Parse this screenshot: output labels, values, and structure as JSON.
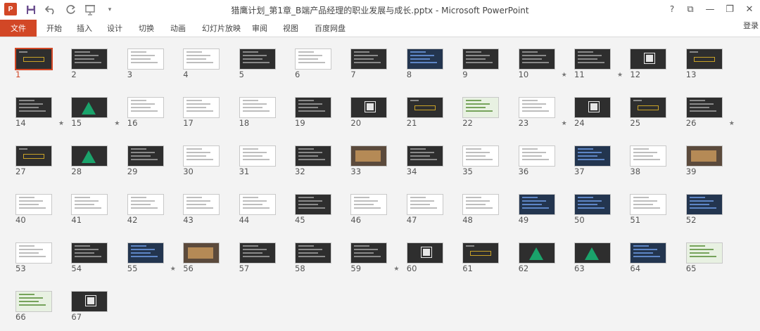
{
  "window": {
    "title": "猎鹰计划_第1章_B端产品经理的职业发展与成长.pptx - Microsoft PowerPoint",
    "app_icon": "P",
    "qat_icons": [
      "save-icon",
      "undo-icon",
      "redo-icon",
      "slideshow-icon",
      "customize-qat-icon"
    ],
    "controls": {
      "help": "?",
      "ribbon_display": "⧉",
      "minimize": "—",
      "restore": "❐",
      "close": "✕"
    }
  },
  "ribbon": {
    "file_tab": "文件",
    "tabs": [
      "开始",
      "插入",
      "设计",
      "切换",
      "动画",
      "幻灯片放映",
      "审阅",
      "视图",
      "百度网盘"
    ],
    "login": "登录",
    "accent": "#d24726"
  },
  "sorter": {
    "selected": 1,
    "slides": [
      {
        "n": "1",
        "star": false,
        "style": "gold"
      },
      {
        "n": "2",
        "star": false,
        "style": "dark"
      },
      {
        "n": "3",
        "star": false,
        "style": "white"
      },
      {
        "n": "4",
        "star": false,
        "style": "white"
      },
      {
        "n": "5",
        "star": false,
        "style": "dark"
      },
      {
        "n": "6",
        "star": false,
        "style": "white"
      },
      {
        "n": "7",
        "star": false,
        "style": "dark"
      },
      {
        "n": "8",
        "star": false,
        "style": "blue"
      },
      {
        "n": "9",
        "star": false,
        "style": "dark"
      },
      {
        "n": "10",
        "star": true,
        "style": "dark"
      },
      {
        "n": "11",
        "star": true,
        "style": "dark"
      },
      {
        "n": "12",
        "star": false,
        "style": "qr"
      },
      {
        "n": "13",
        "star": false,
        "style": "gold"
      },
      {
        "n": "14",
        "star": true,
        "style": "dark"
      },
      {
        "n": "15",
        "star": true,
        "style": "pyr"
      },
      {
        "n": "16",
        "star": false,
        "style": "white"
      },
      {
        "n": "17",
        "star": false,
        "style": "white"
      },
      {
        "n": "18",
        "star": false,
        "style": "white"
      },
      {
        "n": "19",
        "star": false,
        "style": "dark"
      },
      {
        "n": "20",
        "star": false,
        "style": "qr"
      },
      {
        "n": "21",
        "star": false,
        "style": "gold"
      },
      {
        "n": "22",
        "star": false,
        "style": "green"
      },
      {
        "n": "23",
        "star": true,
        "style": "white"
      },
      {
        "n": "24",
        "star": false,
        "style": "qr"
      },
      {
        "n": "25",
        "star": false,
        "style": "gold"
      },
      {
        "n": "26",
        "star": true,
        "style": "dark"
      },
      {
        "n": "27",
        "star": false,
        "style": "gold"
      },
      {
        "n": "28",
        "star": false,
        "style": "pyr"
      },
      {
        "n": "29",
        "star": false,
        "style": "dark"
      },
      {
        "n": "30",
        "star": false,
        "style": "white"
      },
      {
        "n": "31",
        "star": false,
        "style": "white"
      },
      {
        "n": "32",
        "star": false,
        "style": "dark"
      },
      {
        "n": "33",
        "star": false,
        "style": "photo"
      },
      {
        "n": "34",
        "star": false,
        "style": "dark"
      },
      {
        "n": "35",
        "star": false,
        "style": "white"
      },
      {
        "n": "36",
        "star": false,
        "style": "white"
      },
      {
        "n": "37",
        "star": false,
        "style": "blue"
      },
      {
        "n": "38",
        "star": false,
        "style": "white"
      },
      {
        "n": "39",
        "star": false,
        "style": "photo"
      },
      {
        "n": "40",
        "star": false,
        "style": "white"
      },
      {
        "n": "41",
        "star": false,
        "style": "white"
      },
      {
        "n": "42",
        "star": false,
        "style": "white"
      },
      {
        "n": "43",
        "star": false,
        "style": "white"
      },
      {
        "n": "44",
        "star": false,
        "style": "white"
      },
      {
        "n": "45",
        "star": false,
        "style": "dark"
      },
      {
        "n": "46",
        "star": false,
        "style": "white"
      },
      {
        "n": "47",
        "star": false,
        "style": "white"
      },
      {
        "n": "48",
        "star": false,
        "style": "white"
      },
      {
        "n": "49",
        "star": false,
        "style": "blue"
      },
      {
        "n": "50",
        "star": false,
        "style": "blue"
      },
      {
        "n": "51",
        "star": false,
        "style": "white"
      },
      {
        "n": "52",
        "star": false,
        "style": "blue"
      },
      {
        "n": "53",
        "star": false,
        "style": "white"
      },
      {
        "n": "54",
        "star": false,
        "style": "dark"
      },
      {
        "n": "55",
        "star": true,
        "style": "blue"
      },
      {
        "n": "56",
        "star": false,
        "style": "photo"
      },
      {
        "n": "57",
        "star": false,
        "style": "dark"
      },
      {
        "n": "58",
        "star": false,
        "style": "dark"
      },
      {
        "n": "59",
        "star": true,
        "style": "dark"
      },
      {
        "n": "60",
        "star": false,
        "style": "qr"
      },
      {
        "n": "61",
        "star": false,
        "style": "gold"
      },
      {
        "n": "62",
        "star": false,
        "style": "pyr"
      },
      {
        "n": "63",
        "star": false,
        "style": "pyr"
      },
      {
        "n": "64",
        "star": false,
        "style": "blue"
      },
      {
        "n": "65",
        "star": false,
        "style": "green"
      },
      {
        "n": "66",
        "star": false,
        "style": "green"
      },
      {
        "n": "67",
        "star": false,
        "style": "qr"
      }
    ],
    "star_glyph": "★"
  }
}
